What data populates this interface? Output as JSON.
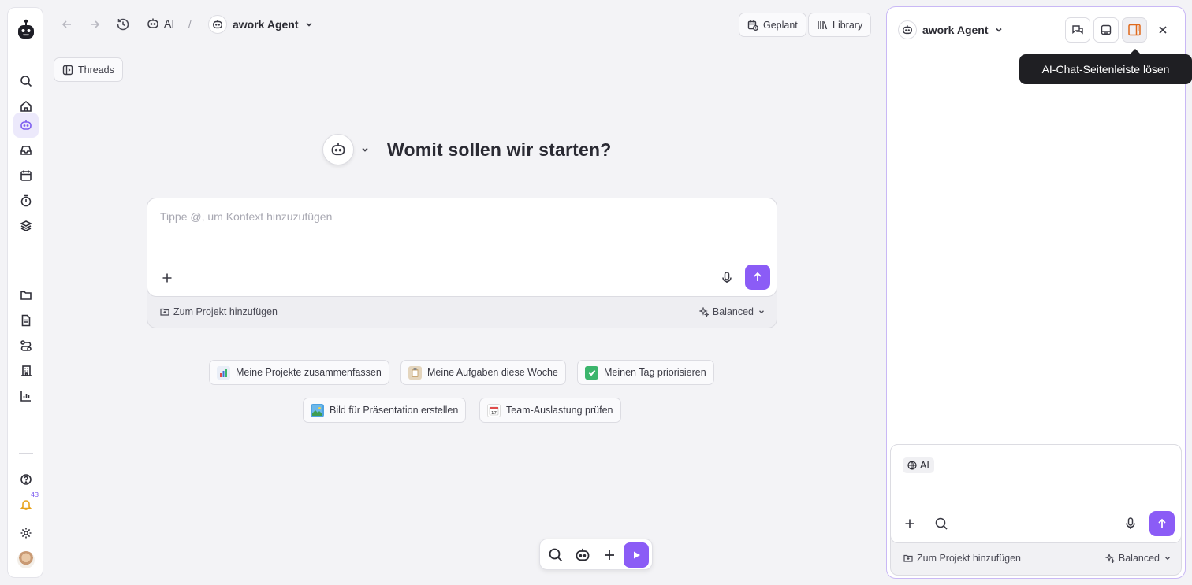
{
  "colors": {
    "accent": "#8b5cf6",
    "active_rail_bg": "#ece9fb",
    "tooltip_bg": "#1f1f23",
    "panel_border": "#c9b8f5"
  },
  "rail": {
    "items": [
      {
        "icon": "search-icon"
      },
      {
        "icon": "home-icon"
      },
      {
        "icon": "ai-bot-icon",
        "active": true
      },
      {
        "icon": "inbox-icon"
      },
      {
        "icon": "calendar-icon"
      },
      {
        "icon": "timer-icon"
      },
      {
        "icon": "layers-icon"
      },
      {
        "icon": "folder-icon"
      },
      {
        "icon": "document-icon"
      },
      {
        "icon": "workflow-icon"
      },
      {
        "icon": "building-icon"
      },
      {
        "icon": "chart-icon"
      },
      {
        "icon": "help-icon"
      },
      {
        "icon": "bell-icon"
      },
      {
        "icon": "settings-icon"
      }
    ],
    "notification_count": "43"
  },
  "topbar": {
    "breadcrumb_ai": "AI",
    "breadcrumb_sep": "/",
    "agent_name": "awork Agent",
    "scheduled_label": "Geplant",
    "library_label": "Library"
  },
  "threads_label": "Threads",
  "hero": {
    "title": "Womit sollen wir starten?"
  },
  "composer": {
    "placeholder": "Tippe @, um Kontext hinzuzufügen",
    "project_label": "Zum Projekt hinzufügen",
    "mode_label": "Balanced"
  },
  "suggestions": [
    {
      "emoji": "📊",
      "label": "Meine Projekte zusammenfassen"
    },
    {
      "emoji": "📋",
      "label": "Meine Aufgaben diese Woche"
    },
    {
      "emoji": "✅",
      "label": "Meinen Tag priorisieren"
    },
    {
      "emoji": "🏞️",
      "label": "Bild für Präsentation erstellen"
    },
    {
      "emoji": "📅",
      "label": "Team-Auslastung prüfen"
    }
  ],
  "panel": {
    "agent_name": "awork Agent",
    "tooltip": "AI-Chat-Seitenleiste lösen",
    "context_chip": "AI",
    "project_label": "Zum Projekt hinzufügen",
    "mode_label": "Balanced"
  }
}
